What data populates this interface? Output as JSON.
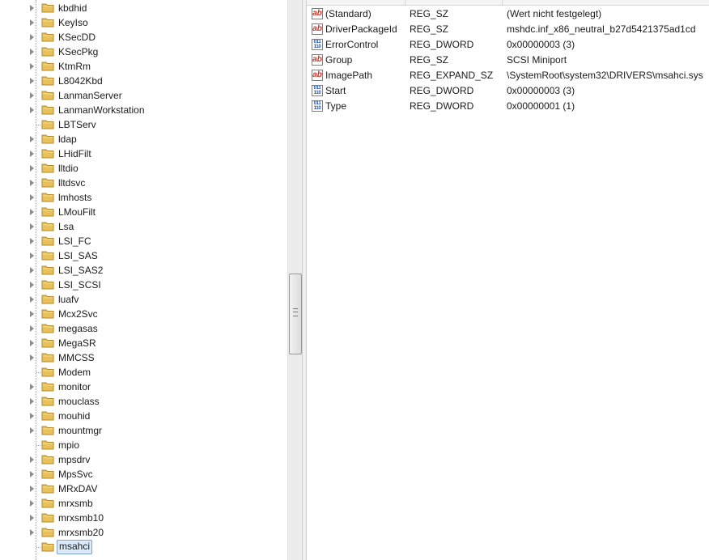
{
  "tree": {
    "items": [
      {
        "label": "kbdhid",
        "expandable": true
      },
      {
        "label": "KeyIso",
        "expandable": true
      },
      {
        "label": "KSecDD",
        "expandable": true
      },
      {
        "label": "KSecPkg",
        "expandable": true
      },
      {
        "label": "KtmRm",
        "expandable": true
      },
      {
        "label": "L8042Kbd",
        "expandable": true
      },
      {
        "label": "LanmanServer",
        "expandable": true
      },
      {
        "label": "LanmanWorkstation",
        "expandable": true
      },
      {
        "label": "LBTServ",
        "expandable": false
      },
      {
        "label": "ldap",
        "expandable": true
      },
      {
        "label": "LHidFilt",
        "expandable": true
      },
      {
        "label": "lltdio",
        "expandable": true
      },
      {
        "label": "lltdsvc",
        "expandable": true
      },
      {
        "label": "lmhosts",
        "expandable": true
      },
      {
        "label": "LMouFilt",
        "expandable": true
      },
      {
        "label": "Lsa",
        "expandable": true
      },
      {
        "label": "LSI_FC",
        "expandable": true
      },
      {
        "label": "LSI_SAS",
        "expandable": true
      },
      {
        "label": "LSI_SAS2",
        "expandable": true
      },
      {
        "label": "LSI_SCSI",
        "expandable": true
      },
      {
        "label": "luafv",
        "expandable": true
      },
      {
        "label": "Mcx2Svc",
        "expandable": true
      },
      {
        "label": "megasas",
        "expandable": true
      },
      {
        "label": "MegaSR",
        "expandable": true
      },
      {
        "label": "MMCSS",
        "expandable": true
      },
      {
        "label": "Modem",
        "expandable": false
      },
      {
        "label": "monitor",
        "expandable": true
      },
      {
        "label": "mouclass",
        "expandable": true
      },
      {
        "label": "mouhid",
        "expandable": true
      },
      {
        "label": "mountmgr",
        "expandable": true
      },
      {
        "label": "mpio",
        "expandable": false
      },
      {
        "label": "mpsdrv",
        "expandable": true
      },
      {
        "label": "MpsSvc",
        "expandable": true
      },
      {
        "label": "MRxDAV",
        "expandable": true
      },
      {
        "label": "mrxsmb",
        "expandable": true
      },
      {
        "label": "mrxsmb10",
        "expandable": true
      },
      {
        "label": "mrxsmb20",
        "expandable": true
      },
      {
        "label": "msahci",
        "expandable": false,
        "selected": true
      }
    ]
  },
  "values": {
    "rows": [
      {
        "icon": "string-value-icon",
        "name": "(Standard)",
        "type": "REG_SZ",
        "data": "(Wert nicht festgelegt)"
      },
      {
        "icon": "string-value-icon",
        "name": "DriverPackageId",
        "type": "REG_SZ",
        "data": "mshdc.inf_x86_neutral_b27d5421375ad1cd"
      },
      {
        "icon": "binary-value-icon",
        "name": "ErrorControl",
        "type": "REG_DWORD",
        "data": "0x00000003 (3)"
      },
      {
        "icon": "string-value-icon",
        "name": "Group",
        "type": "REG_SZ",
        "data": "SCSI Miniport"
      },
      {
        "icon": "string-value-icon",
        "name": "ImagePath",
        "type": "REG_EXPAND_SZ",
        "data": "\\SystemRoot\\system32\\DRIVERS\\msahci.sys"
      },
      {
        "icon": "binary-value-icon",
        "name": "Start",
        "type": "REG_DWORD",
        "data": "0x00000003 (3)"
      },
      {
        "icon": "binary-value-icon",
        "name": "Type",
        "type": "REG_DWORD",
        "data": "0x00000001 (1)"
      }
    ]
  },
  "colors": {
    "folder": "#e8c15a",
    "selection_bg": "#dcebfc",
    "selection_border": "#7da2ce"
  }
}
